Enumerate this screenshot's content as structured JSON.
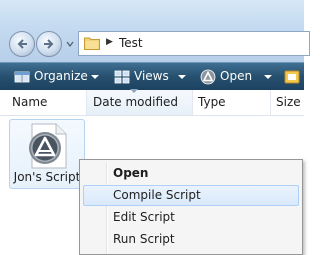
{
  "address_bar": {
    "breadcrumb": "Test",
    "back_icon": "back-arrow-icon",
    "forward_icon": "forward-arrow-icon",
    "folder_icon": "folder-icon"
  },
  "toolbar": {
    "organize_label": "Organize",
    "views_label": "Views",
    "open_label": "Open"
  },
  "columns": {
    "name": "Name",
    "date_modified": "Date modified",
    "type": "Type",
    "size": "Size"
  },
  "file": {
    "name": "Jon's Script",
    "icon": "applescript-icon"
  },
  "context_menu": {
    "items": [
      "Open",
      "Compile Script",
      "Edit Script",
      "Run Script"
    ],
    "highlighted": "Compile Script"
  },
  "colors": {
    "toolbar": "#27506f",
    "address_bar": "#c4daf0",
    "menu_highlight": "#d9e9fb"
  }
}
